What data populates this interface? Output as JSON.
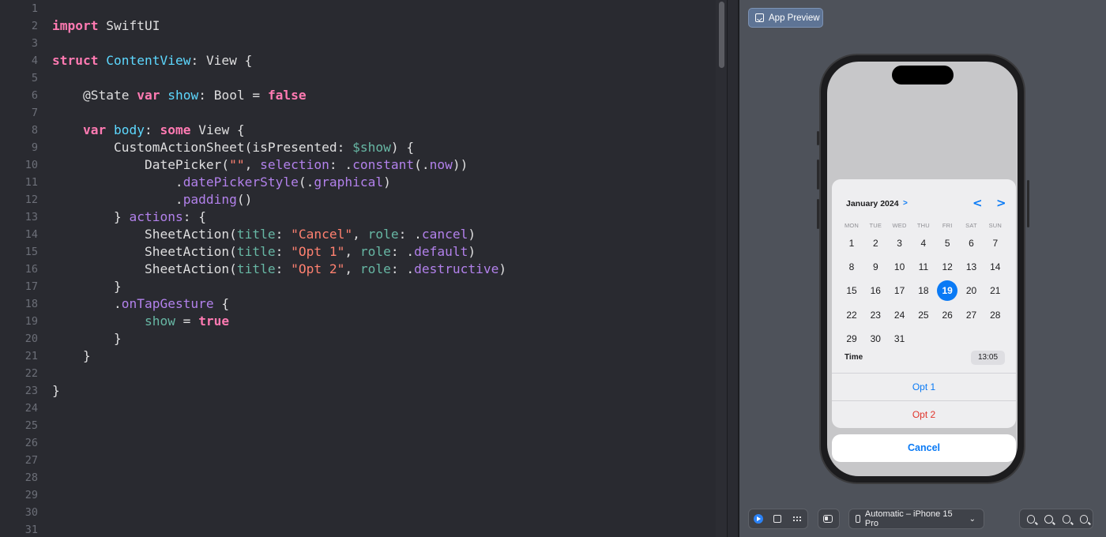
{
  "editor": {
    "line_numbers": [
      "1",
      "2",
      "3",
      "4",
      "5",
      "6",
      "7",
      "8",
      "9",
      "10",
      "11",
      "12",
      "13",
      "14",
      "15",
      "16",
      "17",
      "18",
      "19",
      "20",
      "21",
      "22",
      "23",
      "24",
      "25",
      "26",
      "27",
      "28",
      "29",
      "30",
      "31"
    ],
    "lines": [
      [],
      [
        [
          "keyword",
          "import"
        ],
        [
          "plain",
          " "
        ],
        [
          "type",
          "SwiftUI"
        ]
      ],
      [],
      [
        [
          "keyword",
          "struct"
        ],
        [
          "plain",
          " "
        ],
        [
          "decl",
          "ContentView"
        ],
        [
          "plain",
          ": "
        ],
        [
          "type",
          "View"
        ],
        [
          "plain",
          " {"
        ]
      ],
      [],
      [
        [
          "plain",
          "    "
        ],
        [
          "attr",
          "@State"
        ],
        [
          "plain",
          " "
        ],
        [
          "keyword",
          "var"
        ],
        [
          "plain",
          " "
        ],
        [
          "decl",
          "show"
        ],
        [
          "plain",
          ": "
        ],
        [
          "type",
          "Bool"
        ],
        [
          "plain",
          " = "
        ],
        [
          "keyword",
          "false"
        ]
      ],
      [],
      [
        [
          "plain",
          "    "
        ],
        [
          "keyword",
          "var"
        ],
        [
          "plain",
          " "
        ],
        [
          "decl",
          "body"
        ],
        [
          "plain",
          ": "
        ],
        [
          "keyword",
          "some"
        ],
        [
          "plain",
          " "
        ],
        [
          "type",
          "View"
        ],
        [
          "plain",
          " {"
        ]
      ],
      [
        [
          "plain",
          "        "
        ],
        [
          "type",
          "CustomActionSheet"
        ],
        [
          "plain",
          "("
        ],
        [
          "type",
          "isPresented"
        ],
        [
          "plain",
          ": "
        ],
        [
          "prop",
          "$show"
        ],
        [
          "plain",
          ") {"
        ]
      ],
      [
        [
          "plain",
          "            "
        ],
        [
          "type",
          "DatePicker"
        ],
        [
          "plain",
          "("
        ],
        [
          "string",
          "\"\""
        ],
        [
          "plain",
          ", "
        ],
        [
          "method",
          "selection"
        ],
        [
          "plain",
          ": ."
        ],
        [
          "method",
          "constant"
        ],
        [
          "plain",
          "(."
        ],
        [
          "method",
          "now"
        ],
        [
          "plain",
          "))"
        ]
      ],
      [
        [
          "plain",
          "                ."
        ],
        [
          "method",
          "datePickerStyle"
        ],
        [
          "plain",
          "(."
        ],
        [
          "method",
          "graphical"
        ],
        [
          "plain",
          ")"
        ]
      ],
      [
        [
          "plain",
          "                ."
        ],
        [
          "method",
          "padding"
        ],
        [
          "plain",
          "()"
        ]
      ],
      [
        [
          "plain",
          "        } "
        ],
        [
          "method",
          "actions"
        ],
        [
          "plain",
          ": {"
        ]
      ],
      [
        [
          "plain",
          "            "
        ],
        [
          "type",
          "SheetAction"
        ],
        [
          "plain",
          "("
        ],
        [
          "prop",
          "title"
        ],
        [
          "plain",
          ": "
        ],
        [
          "string",
          "\"Cancel\""
        ],
        [
          "plain",
          ", "
        ],
        [
          "prop",
          "role"
        ],
        [
          "plain",
          ": ."
        ],
        [
          "method",
          "cancel"
        ],
        [
          "plain",
          ")"
        ]
      ],
      [
        [
          "plain",
          "            "
        ],
        [
          "type",
          "SheetAction"
        ],
        [
          "plain",
          "("
        ],
        [
          "prop",
          "title"
        ],
        [
          "plain",
          ": "
        ],
        [
          "string",
          "\"Opt 1\""
        ],
        [
          "plain",
          ", "
        ],
        [
          "prop",
          "role"
        ],
        [
          "plain",
          ": ."
        ],
        [
          "method",
          "default"
        ],
        [
          "plain",
          ")"
        ]
      ],
      [
        [
          "plain",
          "            "
        ],
        [
          "type",
          "SheetAction"
        ],
        [
          "plain",
          "("
        ],
        [
          "prop",
          "title"
        ],
        [
          "plain",
          ": "
        ],
        [
          "string",
          "\"Opt 2\""
        ],
        [
          "plain",
          ", "
        ],
        [
          "prop",
          "role"
        ],
        [
          "plain",
          ": ."
        ],
        [
          "method",
          "destructive"
        ],
        [
          "plain",
          ")"
        ]
      ],
      [
        [
          "plain",
          "        }"
        ]
      ],
      [
        [
          "plain",
          "        ."
        ],
        [
          "method",
          "onTapGesture"
        ],
        [
          "plain",
          " {"
        ]
      ],
      [
        [
          "plain",
          "            "
        ],
        [
          "prop",
          "show"
        ],
        [
          "plain",
          " = "
        ],
        [
          "keyword",
          "true"
        ]
      ],
      [
        [
          "plain",
          "        }"
        ]
      ],
      [
        [
          "plain",
          "    }"
        ]
      ],
      [],
      [
        [
          "plain",
          "}"
        ]
      ],
      [],
      [],
      [],
      [],
      [],
      [],
      [],
      []
    ]
  },
  "canvas": {
    "tab_label": "App Preview",
    "calendar": {
      "month_label": "January 2024",
      "month_chevron": ">",
      "prev_arrow": "<",
      "next_arrow": ">",
      "weekdays": [
        "MON",
        "TUE",
        "WED",
        "THU",
        "FRI",
        "SAT",
        "SUN"
      ],
      "weeks": [
        [
          "1",
          "2",
          "3",
          "4",
          "5",
          "6",
          "7"
        ],
        [
          "8",
          "9",
          "10",
          "11",
          "12",
          "13",
          "14"
        ],
        [
          "15",
          "16",
          "17",
          "18",
          "19",
          "20",
          "21"
        ],
        [
          "22",
          "23",
          "24",
          "25",
          "26",
          "27",
          "28"
        ],
        [
          "29",
          "30",
          "31",
          "",
          "",
          "",
          ""
        ]
      ],
      "selected_day": "19",
      "time_label": "Time",
      "time_value": "13:05"
    },
    "actions": {
      "opt1": "Opt 1",
      "opt2": "Opt 2",
      "cancel": "Cancel"
    },
    "toolbar": {
      "device": "Automatic – iPhone 15 Pro",
      "device_chevron": "⌄",
      "zoom_icons": [
        "zoom-out-icon",
        "zoom-in-icon",
        "zoom-fit-icon",
        "zoom-actual-icon"
      ]
    },
    "colors": {
      "accent": "#0a7af5",
      "destructive": "#e0342b",
      "keyword": "#ff7ab2",
      "declaration": "#5dd8ff",
      "string": "#ff8170",
      "method": "#b281eb",
      "property": "#67b7a4"
    }
  }
}
